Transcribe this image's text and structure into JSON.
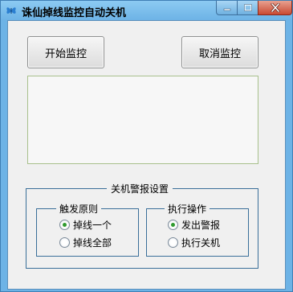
{
  "window": {
    "title": "诛仙掉线监控自动关机",
    "icon": "butterfly-icon",
    "caption_min": "─",
    "caption_max": "□",
    "caption_close": "✕"
  },
  "toolbar": {
    "start_label": "开始监控",
    "cancel_label": "取消监控"
  },
  "monitor": {
    "log_text": ""
  },
  "settings": {
    "group_title": "关机警报设置",
    "trigger": {
      "title": "触发原则",
      "options": [
        {
          "label": "掉线一个",
          "checked": true
        },
        {
          "label": "掉线全部",
          "checked": false
        }
      ]
    },
    "action": {
      "title": "执行操作",
      "options": [
        {
          "label": "发出警报",
          "checked": true
        },
        {
          "label": "执行关机",
          "checked": false
        }
      ]
    }
  },
  "colors": {
    "titlebar": "#6db3e6",
    "client_bg": "#f0f0f0",
    "group_border": "#3a6f99",
    "radio_dot": "#2f9a2f",
    "close_button": "#c94a33"
  }
}
